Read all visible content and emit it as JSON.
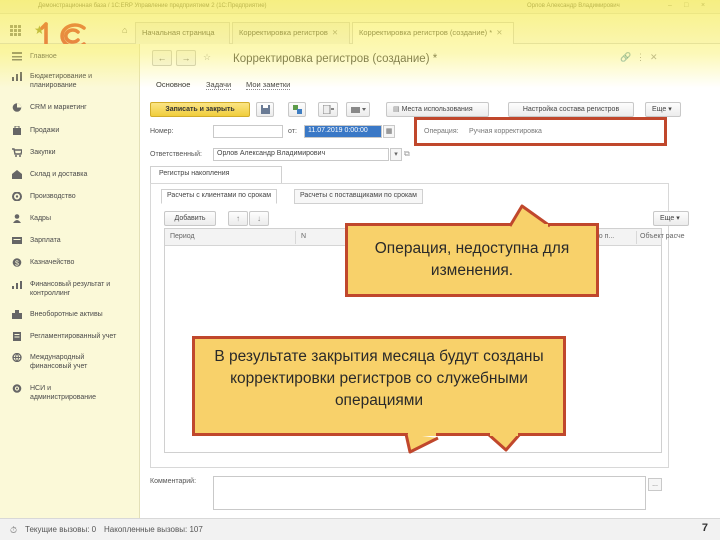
{
  "window": {
    "title": "Демонстрационная база / 1С:ERP Управление предприятием 2  (1С:Предприятие)",
    "user": "Орлов Александр Владимирович"
  },
  "tabs": [
    {
      "label": "Начальная страница",
      "closable": false
    },
    {
      "label": "Корректировка регистров",
      "closable": true
    },
    {
      "label": "Корректировка регистров (создание) *",
      "closable": true
    }
  ],
  "sidebar": {
    "items": [
      {
        "label": "Главное",
        "icon": "menu-icon"
      },
      {
        "label": "Бюджетирование и планирование",
        "icon": "budget-icon"
      },
      {
        "label": "CRM и маркетинг",
        "icon": "pie-icon"
      },
      {
        "label": "Продажи",
        "icon": "sales-icon"
      },
      {
        "label": "Закупки",
        "icon": "cart-icon"
      },
      {
        "label": "Склад и доставка",
        "icon": "warehouse-icon"
      },
      {
        "label": "Производство",
        "icon": "factory-icon"
      },
      {
        "label": "Кадры",
        "icon": "person-icon"
      },
      {
        "label": "Зарплата",
        "icon": "salary-icon"
      },
      {
        "label": "Казначейство",
        "icon": "treasury-icon"
      },
      {
        "label": "Финансовый результат и контроллинг",
        "icon": "finance-icon"
      },
      {
        "label": "Внеоборотные активы",
        "icon": "assets-icon"
      },
      {
        "label": "Регламентированный учет",
        "icon": "ledger-icon"
      },
      {
        "label": "Международный финансовый учет",
        "icon": "globe-icon"
      },
      {
        "label": "НСИ и администрирование",
        "icon": "settings-icon"
      }
    ]
  },
  "form": {
    "title": "Корректировка регистров (создание) *",
    "subtabs": [
      "Основное",
      "Задачи",
      "Мои заметки"
    ],
    "toolbar": {
      "post_close": "Записать и закрыть",
      "usage": "Места использования",
      "registers": "Настройка состава регистров",
      "more": "Еще"
    },
    "number_label": "Номер:",
    "from_label": "от:",
    "date_value": "11.07.2019  0:00:00",
    "operation_label": "Операция:",
    "operation_value": "Ручная корректировка",
    "responsible_label": "Ответственный:",
    "responsible_value": "Орлов Александр Владимирович",
    "group_tab": "Регистры накопления",
    "register_tabs": [
      "Расчеты с клиентами по срокам",
      "Расчеты с поставщиками по срокам"
    ],
    "add_button": "Добавить",
    "table_more": "Еще",
    "columns": [
      "Период",
      "N",
      "по п...",
      "Объект расче"
    ],
    "comment_label": "Комментарий:",
    "comment_btn": "..."
  },
  "callouts": {
    "operation": "Операция, недоступна для изменения.",
    "closing": "В результате закрытия месяца будут созданы корректировки регистров со служебными операциями"
  },
  "status": {
    "current_calls": "Текущие вызовы: 0",
    "accumulated_calls": "Накопленные вызовы: 107"
  },
  "page_number": "7",
  "colors": {
    "highlight_band": "#f7ec3c",
    "callout_fill": "#f8d16a",
    "callout_border": "#c0472c",
    "logo_red": "#d8262c",
    "primary_button": "#f0cd3c"
  }
}
